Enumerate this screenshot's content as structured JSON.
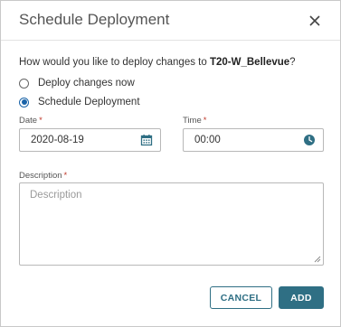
{
  "dialog": {
    "title": "Schedule Deployment",
    "question_prefix": "How would you like to deploy changes to ",
    "question_target": "T20-W_Bellevue",
    "question_suffix": "?",
    "options": [
      {
        "label": "Deploy changes now",
        "checked": false
      },
      {
        "label": "Schedule Deployment",
        "checked": true
      }
    ],
    "date": {
      "label": "Date",
      "required_mark": "*",
      "value": "2020-08-19",
      "icon": "calendar-icon"
    },
    "time": {
      "label": "Time",
      "required_mark": "*",
      "value": "00:00",
      "icon": "clock-icon"
    },
    "description": {
      "label": "Description",
      "required_mark": "*",
      "placeholder": "Description",
      "value": ""
    },
    "buttons": {
      "cancel": "CANCEL",
      "add": "ADD"
    }
  },
  "colors": {
    "accent": "#2f6f84",
    "radio_selected": "#1a63a8",
    "required": "#c0392b"
  }
}
